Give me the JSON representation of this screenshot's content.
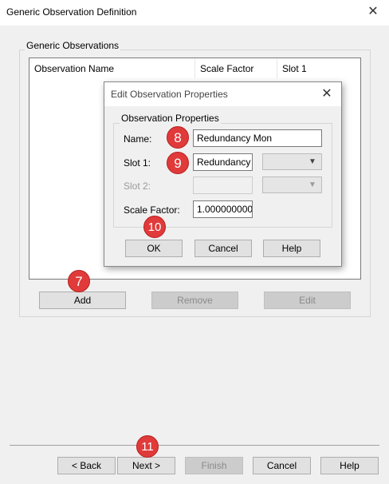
{
  "window": {
    "title": "Generic Observation Definition",
    "close_icon": "✕"
  },
  "group": {
    "label": "Generic Observations"
  },
  "table": {
    "columns": [
      "Observation Name",
      "Scale Factor",
      "Slot 1"
    ]
  },
  "list_buttons": {
    "add": "Add",
    "remove": "Remove",
    "edit": "Edit"
  },
  "dialog": {
    "title": "Edit Observation Properties",
    "close_icon": "✕",
    "group_label": "Observation Properties",
    "name_label": "Name:",
    "name_value": "Redundancy Mon",
    "slot1_label": "Slot 1:",
    "slot1_value": "Redundancy",
    "slot2_label": "Slot 2:",
    "scale_label": "Scale Factor:",
    "scale_value": "1.000000000",
    "ok": "OK",
    "cancel": "Cancel",
    "help": "Help"
  },
  "wizard": {
    "back": "< Back",
    "next": "Next >",
    "finish": "Finish",
    "cancel": "Cancel",
    "help": "Help"
  },
  "badges": {
    "b7": "7",
    "b8": "8",
    "b9": "9",
    "b10": "10",
    "b11": "11"
  },
  "colors": {
    "badge": "#e03a3a",
    "window_bg": "#f0f0f0"
  }
}
